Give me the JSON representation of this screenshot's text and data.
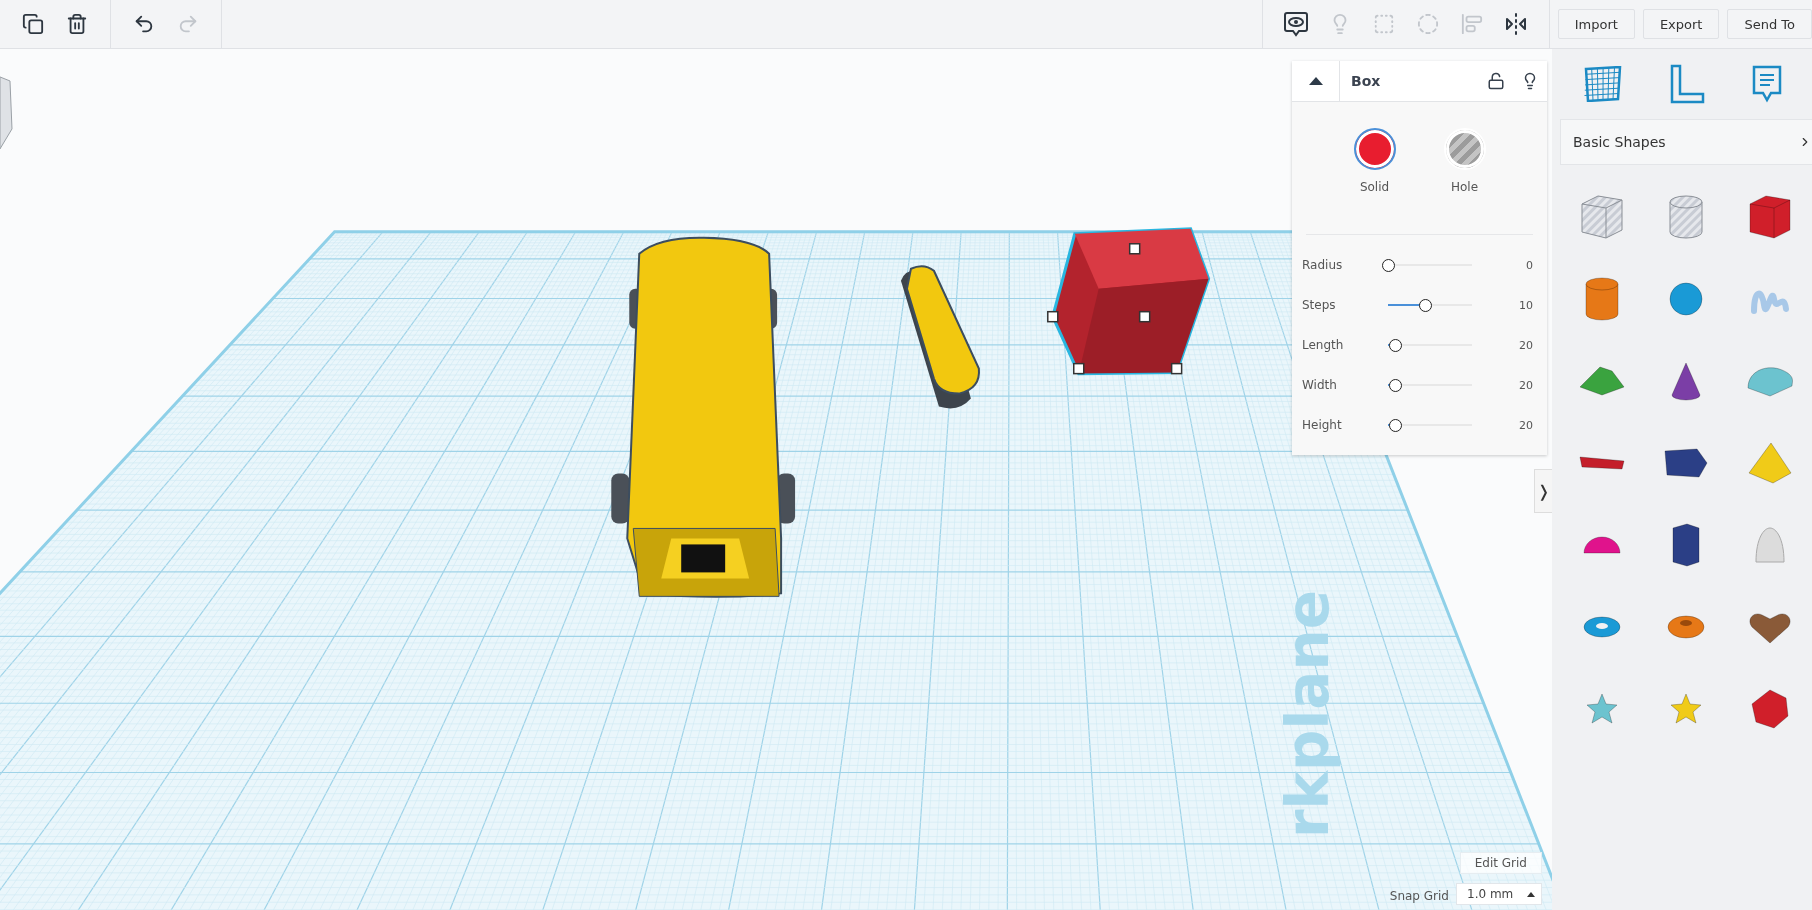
{
  "toolbar_left": [
    {
      "kind": "duplicate",
      "disabled": false
    },
    {
      "kind": "delete",
      "disabled": false
    },
    {
      "kind": "undo",
      "disabled": false
    },
    {
      "kind": "redo",
      "disabled": true
    }
  ],
  "toolbar_right": [
    {
      "kind": "notes-view",
      "disabled": false
    },
    {
      "kind": "light",
      "disabled": true
    },
    {
      "kind": "group",
      "disabled": true
    },
    {
      "kind": "ungroup",
      "disabled": true
    },
    {
      "kind": "align",
      "disabled": true
    },
    {
      "kind": "mirror",
      "disabled": false
    }
  ],
  "actions": [
    "Import",
    "Export",
    "Send To"
  ],
  "inspector": {
    "title": "Box",
    "modes": [
      {
        "kind": "solid",
        "label": "Solid",
        "selected": true
      },
      {
        "kind": "hole",
        "label": "Hole",
        "selected": false
      }
    ],
    "params": [
      {
        "label": "Radius",
        "level": 0,
        "reading": "0"
      },
      {
        "label": "Steps",
        "level": 0.45,
        "reading": "10"
      },
      {
        "label": "Length",
        "level": 0.08,
        "reading": "20"
      },
      {
        "label": "Width",
        "level": 0.08,
        "reading": "20"
      },
      {
        "label": "Height",
        "level": 0.08,
        "reading": "20"
      }
    ]
  },
  "workplane_label": "rkplane",
  "grid": {
    "edit_button": "Edit Grid",
    "snap_label": "Snap Grid",
    "snap_value": "1.0 mm"
  },
  "collapse_tab": "❭",
  "sidebar": {
    "category": "Basic Shapes",
    "shapes": [
      {
        "kind": "box",
        "color": "#c8ccd4",
        "hole": true
      },
      {
        "kind": "cylinder",
        "color": "#c8ccd4",
        "hole": true
      },
      {
        "kind": "box",
        "color": "#d01f2a",
        "hole": false
      },
      {
        "kind": "cylinder",
        "color": "#e67817",
        "hole": false
      },
      {
        "kind": "sphere",
        "color": "#1a9ad6",
        "hole": false
      },
      {
        "kind": "scribble",
        "color": "#a8c8e8",
        "hole": false
      },
      {
        "kind": "roof",
        "color": "#3aa33f",
        "hole": false
      },
      {
        "kind": "cone",
        "color": "#7b3ea6",
        "hole": false
      },
      {
        "kind": "round-roof",
        "color": "#6cc3cf",
        "hole": false
      },
      {
        "kind": "text",
        "color": "#c41e2a",
        "hole": false
      },
      {
        "kind": "polygon",
        "color": "#2b3f86",
        "hole": false
      },
      {
        "kind": "pyramid",
        "color": "#f0cb18",
        "hole": false
      },
      {
        "kind": "half-sphere",
        "color": "#e0138c",
        "hole": false
      },
      {
        "kind": "prism",
        "color": "#2b3f86",
        "hole": false
      },
      {
        "kind": "paraboloid",
        "color": "#dcdcdc",
        "hole": false
      },
      {
        "kind": "torus",
        "color": "#1a9ad6",
        "hole": false
      },
      {
        "kind": "tube",
        "color": "#e67817",
        "hole": false
      },
      {
        "kind": "heart",
        "color": "#8a5a38",
        "hole": false
      },
      {
        "kind": "star",
        "color": "#6cc3cf",
        "hole": false
      },
      {
        "kind": "star",
        "color": "#f0cb18",
        "hole": false
      },
      {
        "kind": "icosahedron",
        "color": "#d01f2a",
        "hole": false
      }
    ]
  }
}
